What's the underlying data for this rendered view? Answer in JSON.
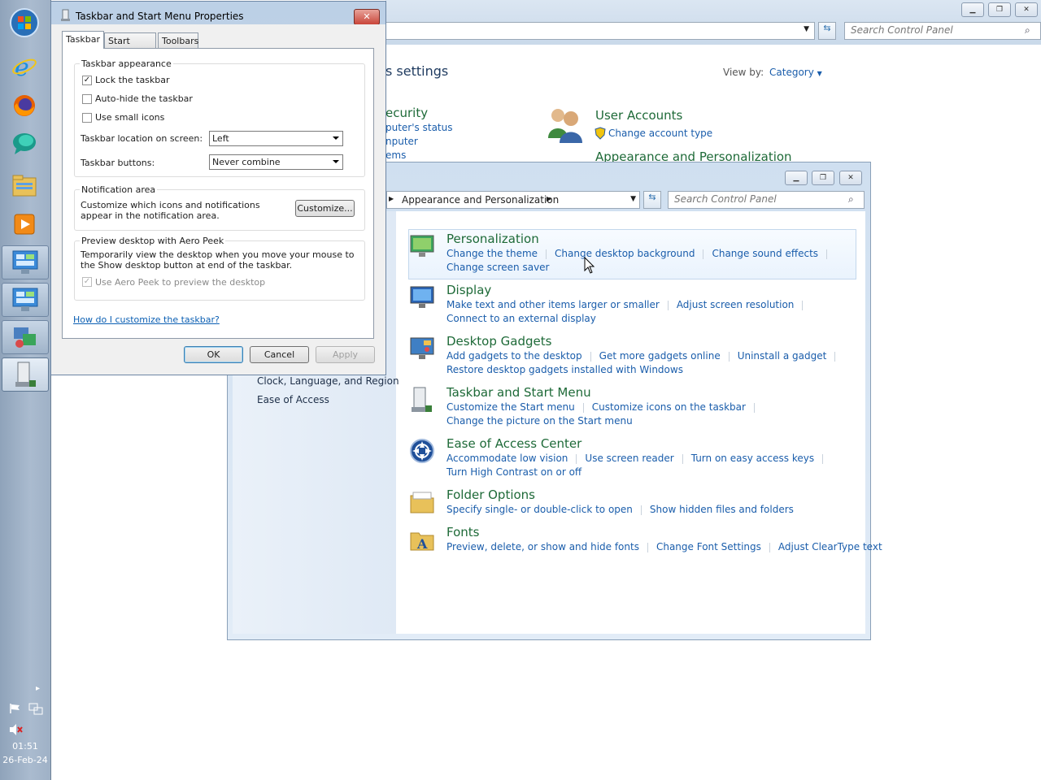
{
  "taskbar": {
    "clock_time": "01:51",
    "clock_date": "26-Feb-24",
    "icons": [
      "start-orb-icon",
      "internet-explorer-icon",
      "firefox-icon",
      "messenger-icon",
      "file-explorer-icon",
      "media-player-icon",
      "control-panel-icon",
      "control-panel-icon",
      "taskbar-properties-icon",
      "taskbar-properties-icon"
    ]
  },
  "cp_back": {
    "search_placeholder": "Search Control Panel",
    "heading": "s settings",
    "view_by_label": "View by:",
    "view_by_value": "Category",
    "left_partial": [
      "ecurity",
      "puter's status",
      "nputer",
      "ems"
    ],
    "user_accounts_title": "User Accounts",
    "user_accounts_link": "Change account type",
    "appearance_title": "Appearance and Personalization"
  },
  "cp_front": {
    "breadcrumb": "Appearance and Personalization",
    "search_placeholder": "Search Control Panel",
    "left_items": [
      "Clock, Language, and Region",
      "Ease of Access"
    ],
    "categories": [
      {
        "title": "Personalization",
        "row1": [
          "Change the theme",
          "Change desktop background",
          "Change sound effects"
        ],
        "row2": [
          "Change screen saver"
        ]
      },
      {
        "title": "Display",
        "row1": [
          "Make text and other items larger or smaller",
          "Adjust screen resolution"
        ],
        "row2": [
          "Connect to an external display"
        ]
      },
      {
        "title": "Desktop Gadgets",
        "row1": [
          "Add gadgets to the desktop",
          "Get more gadgets online",
          "Uninstall a gadget"
        ],
        "row2": [
          "Restore desktop gadgets installed with Windows"
        ]
      },
      {
        "title": "Taskbar and Start Menu",
        "row1": [
          "Customize the Start menu",
          "Customize icons on the taskbar"
        ],
        "row2": [
          "Change the picture on the Start menu"
        ]
      },
      {
        "title": "Ease of Access Center",
        "row1": [
          "Accommodate low vision",
          "Use screen reader",
          "Turn on easy access keys"
        ],
        "row2": [
          "Turn High Contrast on or off"
        ]
      },
      {
        "title": "Folder Options",
        "row1": [
          "Specify single- or double-click to open",
          "Show hidden files and folders"
        ],
        "row2": []
      },
      {
        "title": "Fonts",
        "row1": [
          "Preview, delete, or show and hide fonts",
          "Change Font Settings",
          "Adjust ClearType text"
        ],
        "row2": []
      }
    ]
  },
  "dialog": {
    "title": "Taskbar and Start Menu Properties",
    "tabs": [
      "Taskbar",
      "Start Menu",
      "Toolbars"
    ],
    "appearance_group": "Taskbar appearance",
    "lock_taskbar": "Lock the taskbar",
    "lock_checked": true,
    "autohide": "Auto-hide the taskbar",
    "small_icons": "Use small icons",
    "location_label": "Taskbar location on screen:",
    "location_value": "Left",
    "buttons_label": "Taskbar buttons:",
    "buttons_value": "Never combine",
    "notif_group": "Notification area",
    "notif_text": "Customize which icons and notifications appear in the notification area.",
    "customize_btn": "Customize...",
    "peek_group": "Preview desktop with Aero Peek",
    "peek_text": "Temporarily view the desktop when you move your mouse to the Show desktop button at end of the taskbar.",
    "peek_check": "Use Aero Peek to preview the desktop",
    "help_link": "How do I customize the taskbar?",
    "ok": "OK",
    "cancel": "Cancel",
    "apply": "Apply"
  }
}
